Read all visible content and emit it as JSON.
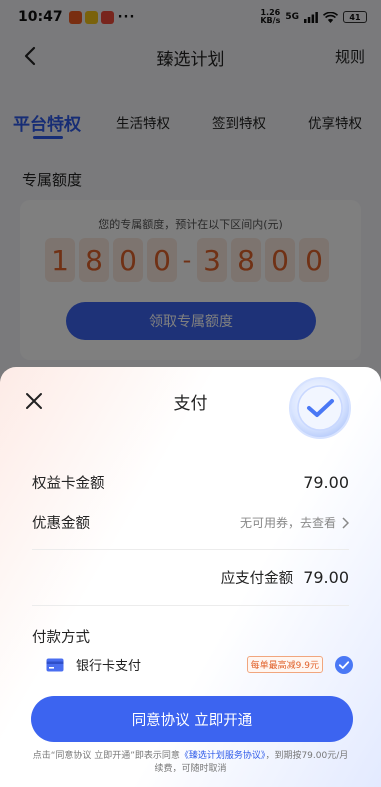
{
  "status_bar": {
    "time": "10:47",
    "net_speed_value": "1.26",
    "net_speed_unit": "KB/s",
    "signal": "5G",
    "battery": "41",
    "more": "···"
  },
  "header": {
    "title": "臻选计划",
    "rules": "规则"
  },
  "tabs": [
    {
      "label": "平台特权",
      "active": true
    },
    {
      "label": "生活特权",
      "active": false
    },
    {
      "label": "签到特权",
      "active": false
    },
    {
      "label": "优享特权",
      "active": false
    }
  ],
  "quota": {
    "section_title": "专属额度",
    "description": "您的专属额度，预计在以下区间内(元)",
    "digits_low": [
      "1",
      "8",
      "0",
      "0"
    ],
    "separator": "-",
    "digits_high": [
      "3",
      "8",
      "0",
      "0"
    ],
    "claim_button": "领取专属额度"
  },
  "payment_sheet": {
    "title": "支付",
    "benefit_card_label": "权益卡金额",
    "benefit_card_amount": "79.00",
    "discount_label": "优惠金额",
    "discount_link": "无可用券，去查看",
    "payable_label": "应支付金额",
    "payable_amount": "79.00",
    "method_title": "付款方式",
    "method_label": "银行卡支付",
    "promo_badge": "每单最高减9.9元",
    "open_button": "同意协议 立即开通",
    "agreement_prefix": "点击“同意协议 立即开通”即表示同意",
    "agreement_link": "《臻选计划服务协议》",
    "agreement_suffix": "，到期按79.00元/月续费，可随时取消"
  },
  "colors": {
    "accent": "#3c64f0",
    "digit_text": "#e1622b",
    "digit_bg": "#fbe9df"
  }
}
